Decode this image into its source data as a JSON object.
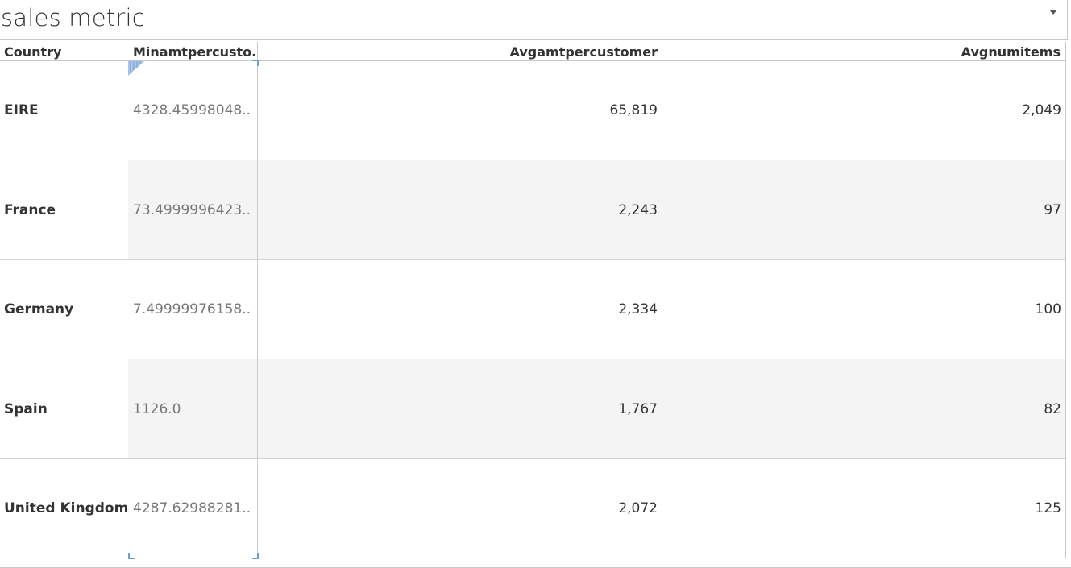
{
  "title": "sales metric",
  "columns": {
    "country": "Country",
    "min": "Minamtpercusto..",
    "avgamt": "Avgamtpercustomer",
    "avgnum": "Avgnumitems"
  },
  "rows": [
    {
      "country": "EIRE",
      "min": "4328.45998048..",
      "avgamt": "65,819",
      "avgnum": "2,049"
    },
    {
      "country": "France",
      "min": "73.4999996423..",
      "avgamt": "2,243",
      "avgnum": "97"
    },
    {
      "country": "Germany",
      "min": "7.49999976158..",
      "avgamt": "2,334",
      "avgnum": "100"
    },
    {
      "country": "Spain",
      "min": "1126.0",
      "avgamt": "1,767",
      "avgnum": "82"
    },
    {
      "country": "United Kingdom",
      "min": "4287.62988281..",
      "avgamt": "2,072",
      "avgnum": "125"
    }
  ],
  "colors": {
    "band": "#f4f4f4",
    "selection": "#6f9fd8",
    "gridline": "#c9c9c9"
  }
}
